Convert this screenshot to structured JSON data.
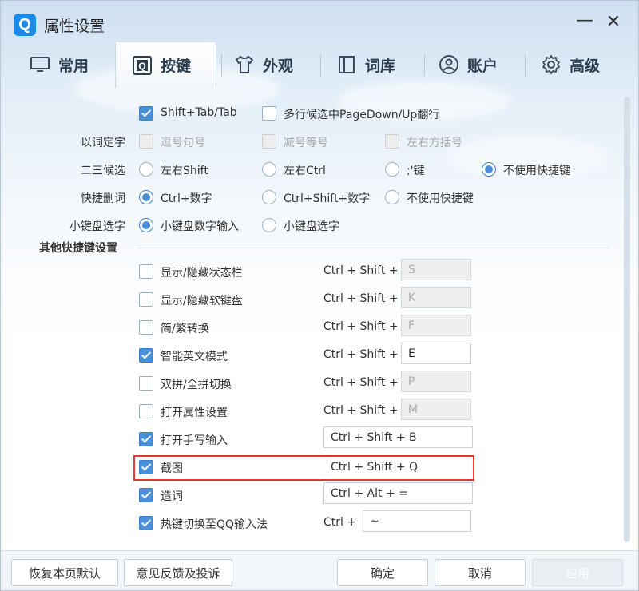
{
  "window": {
    "title": "属性设置",
    "logo": "Q"
  },
  "tabs": [
    {
      "label": "常用",
      "icon": "monitor-icon"
    },
    {
      "label": "按键",
      "icon": "keyboard-q-icon",
      "active": true
    },
    {
      "label": "外观",
      "icon": "tshirt-icon"
    },
    {
      "label": "词库",
      "icon": "book-icon"
    },
    {
      "label": "账户",
      "icon": "user-icon"
    },
    {
      "label": "高级",
      "icon": "gear-icon"
    }
  ],
  "rows": {
    "top": {
      "shift_tab": {
        "label": "Shift+Tab/Tab",
        "checked": true
      },
      "multiline": {
        "label": "多行候选中PageDown/Up翻行",
        "checked": false
      }
    },
    "yici": {
      "label": "以词定字",
      "options": [
        "逗号句号",
        "减号等号",
        "左右方括号"
      ]
    },
    "ersan": {
      "label": "二三候选",
      "options": [
        "左右Shift",
        "左右Ctrl",
        ";'键",
        "不使用快捷键"
      ],
      "selected": 3
    },
    "kuaijie": {
      "label": "快捷删词",
      "options": [
        "Ctrl+数字",
        "Ctrl+Shift+数字",
        "不使用快捷键"
      ],
      "selected": 0
    },
    "xiaojianpan": {
      "label": "小键盘选字",
      "options": [
        "小键盘数字输入",
        "小键盘选字"
      ],
      "selected": 0
    }
  },
  "other": {
    "title": "其他快捷键设置",
    "items": [
      {
        "label": "显示/隐藏状态栏",
        "checked": false,
        "prefix": "Ctrl + Shift +",
        "key": "S",
        "wide": false
      },
      {
        "label": "显示/隐藏软键盘",
        "checked": false,
        "prefix": "Ctrl + Shift +",
        "key": "K",
        "wide": false
      },
      {
        "label": "简/繁转换",
        "checked": false,
        "prefix": "Ctrl + Shift +",
        "key": "F",
        "wide": false
      },
      {
        "label": "智能英文模式",
        "checked": true,
        "prefix": "Ctrl + Shift +",
        "key": "E",
        "wide": false
      },
      {
        "label": "双拼/全拼切换",
        "checked": false,
        "prefix": "Ctrl + Shift +",
        "key": "P",
        "wide": false
      },
      {
        "label": "打开属性设置",
        "checked": false,
        "prefix": "Ctrl + Shift +",
        "key": "M",
        "wide": false
      },
      {
        "label": "打开手写输入",
        "checked": true,
        "prefix": "",
        "key": "Ctrl + Shift + B",
        "wide": true
      },
      {
        "label": "截图",
        "checked": true,
        "prefix": "",
        "key": "Ctrl + Shift + Q",
        "wide": true
      },
      {
        "label": "造词",
        "checked": true,
        "prefix": "",
        "key": "Ctrl + Alt + =",
        "wide": true
      },
      {
        "label": "热键切换至QQ输入法",
        "checked": true,
        "prefix": "Ctrl +",
        "key": "~",
        "wide": false
      }
    ]
  },
  "footer": {
    "restore": "恢复本页默认",
    "feedback": "意见反馈及投诉",
    "ok": "确定",
    "cancel": "取消",
    "apply": "应用"
  },
  "colors": {
    "accent": "#4a90d9",
    "highlight": "#e53935"
  }
}
